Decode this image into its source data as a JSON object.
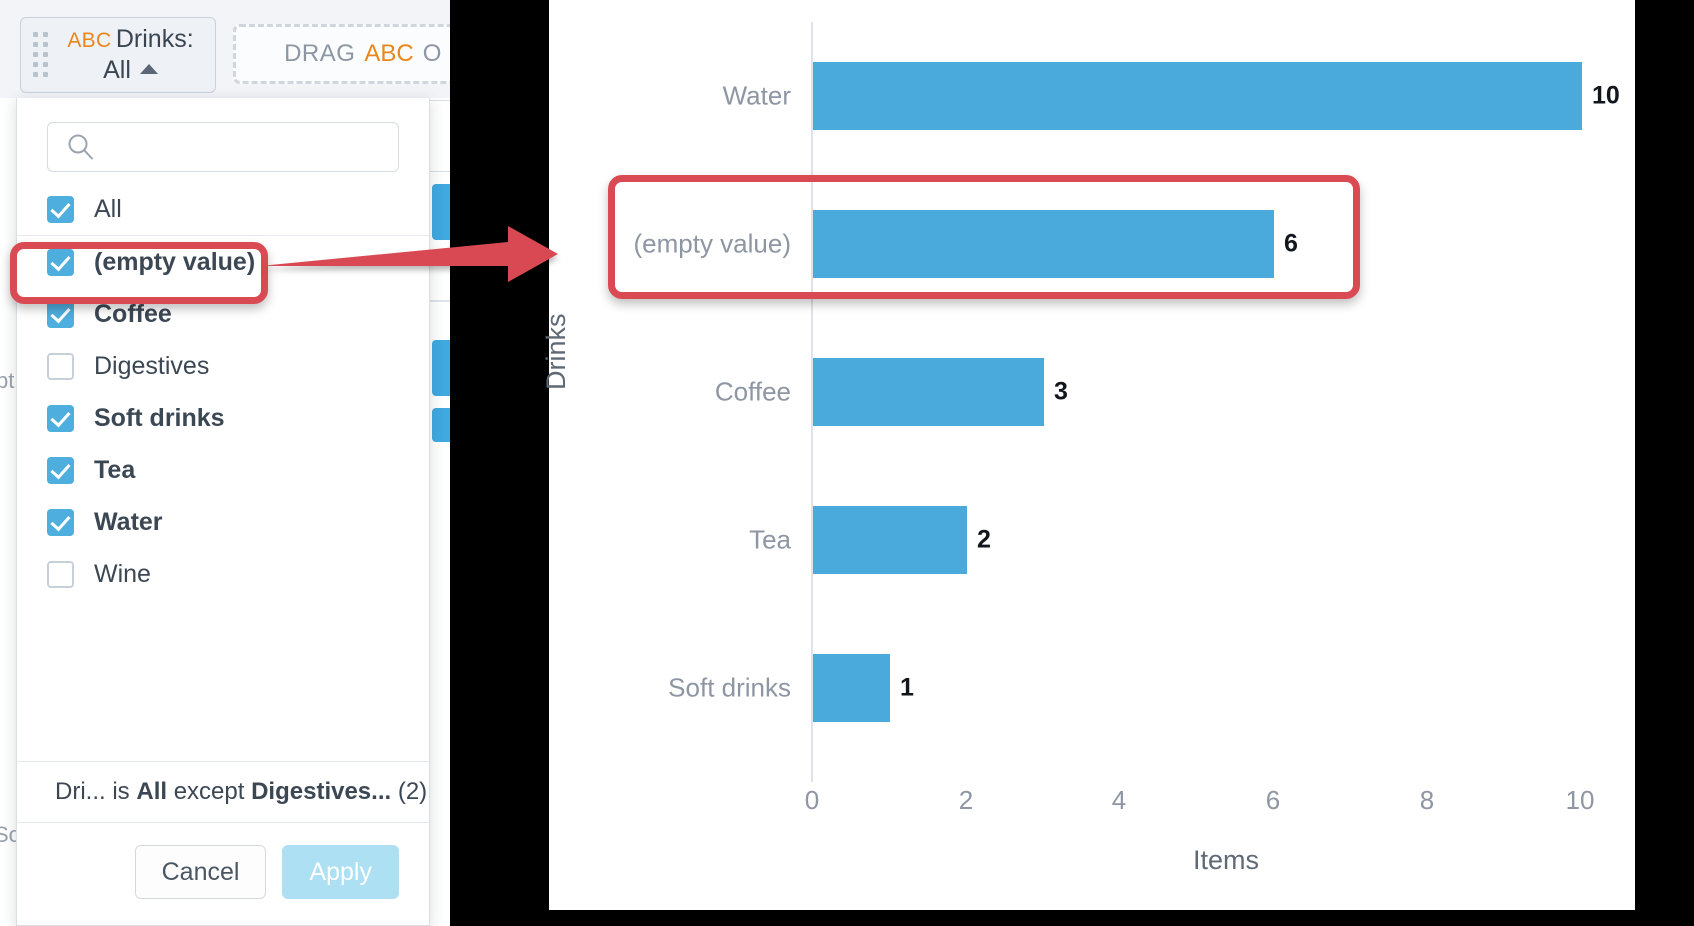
{
  "filter_pill": {
    "type_badge": "ABC",
    "title": "Drinks:",
    "value": "All",
    "caret_icon": "chevron-up-icon"
  },
  "drop_zone": {
    "drag_word": "DRAG",
    "abc_badge": "ABC",
    "trailing_text": "O"
  },
  "ghost_text": {
    "left_mid": "pt",
    "left_bottom": "So"
  },
  "dropdown": {
    "search": {
      "value": "",
      "placeholder": "",
      "icon": "search-icon"
    },
    "items": [
      {
        "label": "All",
        "checked": true,
        "bold": false,
        "rule_below": true
      },
      {
        "label": "(empty value)",
        "checked": true,
        "bold": true,
        "rule_below": false
      },
      {
        "label": "Coffee",
        "checked": true,
        "bold": true,
        "rule_below": false
      },
      {
        "label": "Digestives",
        "checked": false,
        "bold": false,
        "rule_below": false
      },
      {
        "label": "Soft drinks",
        "checked": true,
        "bold": true,
        "rule_below": false
      },
      {
        "label": "Tea",
        "checked": true,
        "bold": true,
        "rule_below": false
      },
      {
        "label": "Water",
        "checked": true,
        "bold": true,
        "rule_below": false
      },
      {
        "label": "Wine",
        "checked": false,
        "bold": false,
        "rule_below": false
      }
    ],
    "summary": {
      "field": "Dri...",
      "verb": "is",
      "mode": "All",
      "except_word": "except",
      "excluded": "Digestives...",
      "count": "(2)"
    },
    "cancel_label": "Cancel",
    "apply_label": "Apply"
  },
  "colors": {
    "bar": "#4aaadc",
    "checkbox_on": "#4eaede",
    "annotation": "#d94a52",
    "apply_button": "#ade0f2",
    "abc_badge": "#e8871a"
  },
  "chart_data": {
    "type": "bar",
    "orientation": "horizontal",
    "title": "",
    "categories": [
      "Water",
      "(empty value)",
      "Coffee",
      "Tea",
      "Soft drinks"
    ],
    "values": [
      10,
      6,
      3,
      2,
      1
    ],
    "value_labels": [
      "10",
      "6",
      "3",
      "2",
      "1"
    ],
    "xlabel": "Items",
    "ylabel": "Drinks",
    "xticks": [
      "0",
      "2",
      "4",
      "6",
      "8",
      "10"
    ],
    "xtick_values": [
      0,
      2,
      4,
      6,
      8,
      10
    ],
    "xlim": [
      0,
      10.8
    ],
    "grid": false,
    "legend": "none"
  },
  "annotations": [
    {
      "name": "highlight-empty-value-checkbox",
      "shape": "rounded-rect"
    },
    {
      "name": "highlight-empty-value-bar",
      "shape": "rounded-rect"
    },
    {
      "name": "pointer-arrow",
      "shape": "arrow"
    }
  ]
}
